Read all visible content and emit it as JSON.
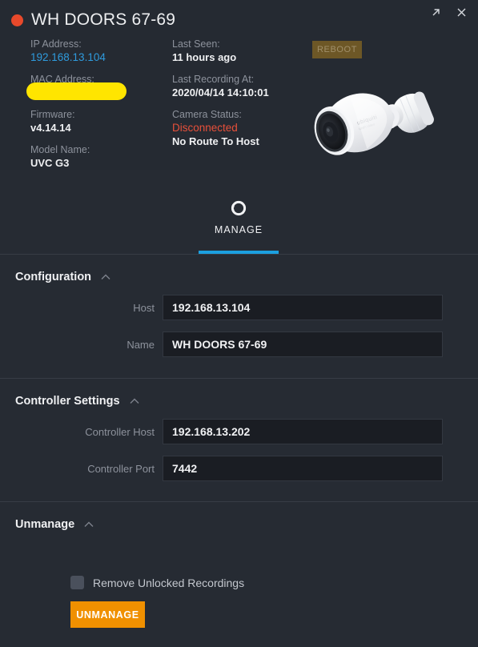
{
  "window": {
    "title": "WH DOORS 67-69",
    "status_dot_color": "#e8492b",
    "expand_icon": "expand-arrow-icon",
    "close_icon": "close-icon"
  },
  "info": {
    "column1": [
      {
        "label": "IP Address:",
        "value": "192.168.13.104",
        "style": "link"
      },
      {
        "label": "MAC Address:",
        "value": "",
        "style": "redacted"
      },
      {
        "label": "Firmware:",
        "value": "v4.14.14",
        "style": "normal"
      },
      {
        "label": "Model Name:",
        "value": "UVC G3",
        "style": "normal"
      }
    ],
    "column2": [
      {
        "label": "Last Seen:",
        "value": "11 hours ago",
        "style": "normal"
      },
      {
        "label": "Last Recording At:",
        "value": "2020/04/14 14:10:01",
        "style": "normal"
      },
      {
        "label": "Camera Status:",
        "value": "Disconnected",
        "value2": "No Route To Host",
        "style": "alert"
      }
    ]
  },
  "reboot": {
    "label": "REBOOT",
    "color": "#6d5726",
    "text_color": "#a08f6a"
  },
  "camera": {
    "alt_name": "uvc-g3-bullet-camera"
  },
  "tabs": [
    {
      "label": "MANAGE",
      "icon": "gear-icon",
      "active": true,
      "accent": "#1ca0e0"
    }
  ],
  "sections": {
    "configuration": {
      "title": "Configuration",
      "collapse_icon": "chevron-up-icon",
      "fields": [
        {
          "label": "Host",
          "value": "192.168.13.104"
        },
        {
          "label": "Name",
          "value": "WH DOORS 67-69"
        }
      ]
    },
    "controller_settings": {
      "title": "Controller Settings",
      "collapse_icon": "chevron-up-icon",
      "fields": [
        {
          "label": "Controller Host",
          "value": "192.168.13.202"
        },
        {
          "label": "Controller Port",
          "value": "7442"
        }
      ]
    },
    "unmanage": {
      "title": "Unmanage",
      "collapse_icon": "chevron-up-icon",
      "checkbox_label": "Remove Unlocked Recordings",
      "checkbox_checked": false,
      "button_label": "UNMANAGE",
      "button_color": "#f09000"
    }
  }
}
